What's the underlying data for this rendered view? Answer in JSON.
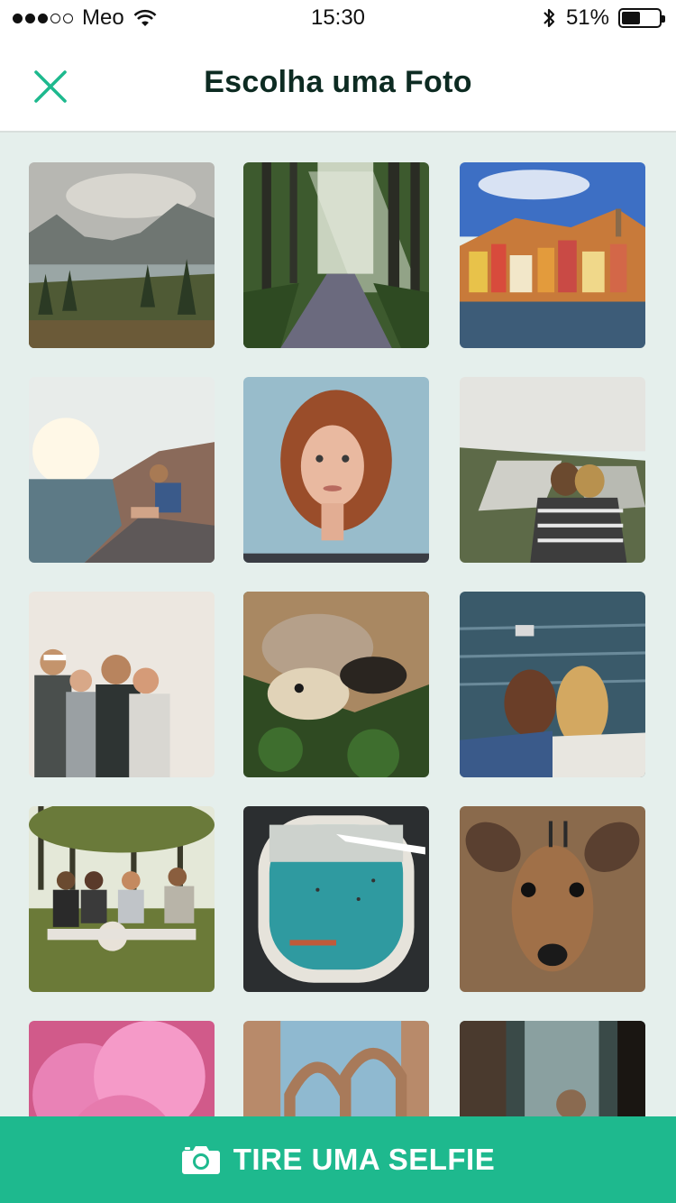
{
  "status_bar": {
    "carrier": "Meo",
    "time": "15:30",
    "battery_percent": "51%",
    "battery_level": 0.51,
    "signal_bars_filled": 3,
    "signal_bars_total": 5
  },
  "header": {
    "title": "Escolha uma Foto",
    "close_icon": "close-icon"
  },
  "photos": [
    {
      "subject": "mountain-lake-landscape"
    },
    {
      "subject": "forest-path-sunrays"
    },
    {
      "subject": "porto-riverside-houses"
    },
    {
      "subject": "woman-sitting-on-rocks-by-sea"
    },
    {
      "subject": "red-haired-woman-portrait"
    },
    {
      "subject": "couple-wrapped-in-blanket-cliff"
    },
    {
      "subject": "group-of-friends-laughing"
    },
    {
      "subject": "cat-and-dog-on-grass"
    },
    {
      "subject": "couple-taking-selfie-by-sea"
    },
    {
      "subject": "friends-picnic-with-dog"
    },
    {
      "subject": "airplane-window-view"
    },
    {
      "subject": "small-deer-face"
    },
    {
      "subject": "pink-smoke"
    },
    {
      "subject": "gothic-ruins-arches"
    },
    {
      "subject": "man-in-forest"
    }
  ],
  "footer": {
    "selfie_label": "TIRE UMA SELFIE",
    "camera_icon": "camera-icon"
  },
  "colors": {
    "accent": "#1eb98e",
    "title": "#0d2b22",
    "background": "#e5efec"
  }
}
